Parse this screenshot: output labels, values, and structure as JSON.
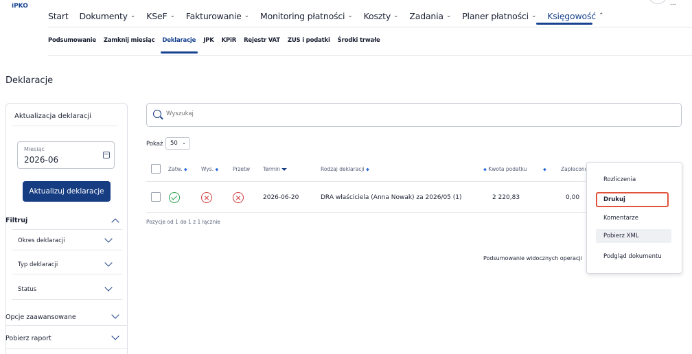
{
  "app": {
    "logo": "iPKO"
  },
  "header": {
    "user_fragment": "..."
  },
  "mainnav": {
    "items": [
      {
        "label": "Start",
        "chevron": ""
      },
      {
        "label": "Dokumenty",
        "chevron": "⌄"
      },
      {
        "label": "KSeF",
        "chevron": "⌄"
      },
      {
        "label": "Fakturowanie",
        "chevron": "⌄"
      },
      {
        "label": "Monitoring płatności",
        "chevron": "⌄"
      },
      {
        "label": "Koszty",
        "chevron": "⌄"
      },
      {
        "label": "Zadania",
        "chevron": "⌄"
      },
      {
        "label": "Planer płatności",
        "chevron": "⌄"
      },
      {
        "label": "Księgowość",
        "chevron": "⌃"
      }
    ]
  },
  "subnav": {
    "items": [
      "Podsumowanie",
      "Zamknij miesiąc",
      "Deklaracje",
      "JPK",
      "KPiR",
      "Rejestr VAT",
      "ZUS i podatki",
      "Środki trwałe"
    ]
  },
  "page": {
    "title": "Deklaracje"
  },
  "sidebar": {
    "title": "Aktualizacja deklaracji",
    "month_label": "Miesiąc",
    "month_value": "2026-06",
    "update_button": "Aktualizuj deklaracje",
    "filter_title": "Filtruj",
    "filters": [
      "Okres deklaracji",
      "Typ deklaracji",
      "Status"
    ],
    "advanced": "Opcje zaawansowane",
    "report": "Pobierz raport"
  },
  "search": {
    "placeholder": "Wyszukaj"
  },
  "table": {
    "show_label": "Pokaż",
    "page_size": "50",
    "headers": {
      "approved": "Zatw.",
      "sent": "Wys.",
      "processed": "Przetw",
      "due": "Termin",
      "type": "Rodzaj deklaracji",
      "tax": "Kwota podatku",
      "paid": "Zapłacono"
    },
    "rows": [
      {
        "due": "2026-06-20",
        "type": "DRA właściciela (Anna Nowak) za 2026/05 (1)",
        "tax": "2 220,83",
        "paid": "0,00"
      }
    ],
    "pagination": "Pozycje od 1 do 1 z 1 łącznie",
    "summary": "Podsumowanie widocznych operacji"
  },
  "context_menu": {
    "items": [
      "Rozliczenia",
      "Drukuj",
      "Komentarze",
      "Pobierz XML",
      "Podgląd dokumentu"
    ]
  },
  "colors": {
    "brand": "#163c82",
    "ok": "#27a04a",
    "error": "#d23b3b",
    "highlight": "#e0533a"
  }
}
